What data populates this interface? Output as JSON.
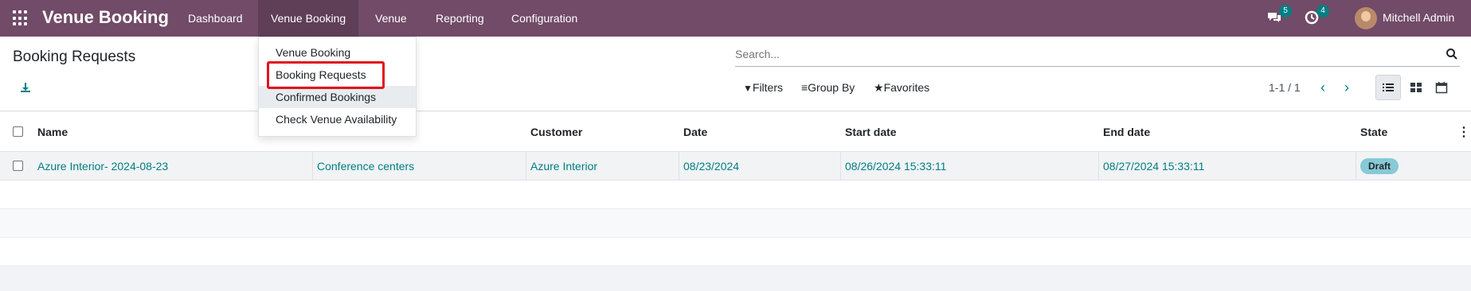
{
  "navbar": {
    "app_name": "Venue Booking",
    "menus": [
      "Dashboard",
      "Venue Booking",
      "Venue",
      "Reporting",
      "Configuration"
    ],
    "active_menu": "Venue Booking",
    "messages_count": "5",
    "activities_count": "4",
    "user_name": "Mitchell Admin"
  },
  "page": {
    "title": "Booking Requests",
    "search_placeholder": "Search...",
    "filters_label": "Filters",
    "groupby_label": "Group By",
    "favorites_label": "Favorites",
    "pager": "1-1 / 1"
  },
  "dropdown": {
    "items": [
      "Venue Booking",
      "Booking Requests",
      "Confirmed Bookings",
      "Check Venue Availability"
    ],
    "highlighted": "Booking Requests",
    "hovered": "Confirmed Bookings"
  },
  "table": {
    "columns": [
      "Name",
      "",
      "Customer",
      "Date",
      "Start date",
      "End date",
      "State"
    ],
    "rows": [
      {
        "name": "Azure Interior- 2024-08-23",
        "venue_type": "Conference centers",
        "customer": "Azure Interior",
        "date": "08/23/2024",
        "start_date": "08/26/2024 15:33:11",
        "end_date": "08/27/2024 15:33:11",
        "state": "Draft"
      }
    ]
  },
  "colors": {
    "navbar": "#714b67",
    "accent": "#017e84",
    "highlight": "#e3121b",
    "state_badge": "#87c9d6"
  }
}
